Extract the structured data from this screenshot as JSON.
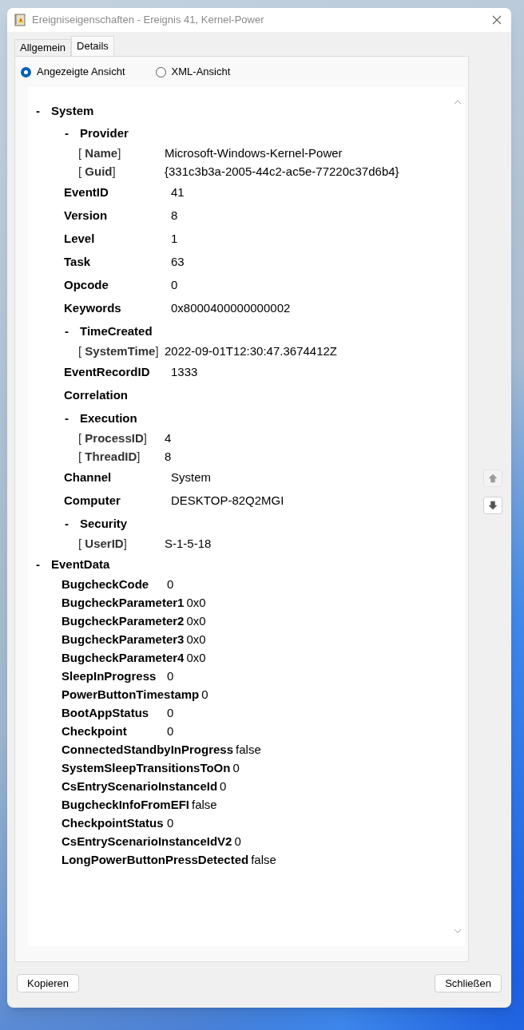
{
  "window": {
    "title": "Ereigniseigenschaften - Ereignis 41, Kernel-Power"
  },
  "tabs": [
    {
      "label": "Allgemein",
      "selected": false
    },
    {
      "label": "Details",
      "selected": true
    }
  ],
  "view_options": [
    {
      "label": "Angezeigte Ansicht",
      "selected": true
    },
    {
      "label": "XML-Ansicht",
      "selected": false
    }
  ],
  "tree": [
    {
      "kind": "group",
      "toggle": "-",
      "label": "System",
      "children": [
        {
          "kind": "group",
          "toggle": "-",
          "label": "Provider",
          "children": [
            {
              "kind": "attribute",
              "name": "[ **Name**]",
              "value": "Microsoft-Windows-Kernel-Power"
            },
            {
              "kind": "attribute",
              "name": "[ **Guid**]",
              "value": "{331c3b3a-2005-44c2-ac5e-77220c37d6b4}"
            }
          ]
        },
        {
          "kind": "field",
          "name": "EventID",
          "value": "41"
        },
        {
          "kind": "field",
          "name": "Version",
          "value": "8"
        },
        {
          "kind": "field",
          "name": "Level",
          "value": "1"
        },
        {
          "kind": "field",
          "name": "Task",
          "value": "63"
        },
        {
          "kind": "field",
          "name": "Opcode",
          "value": "0"
        },
        {
          "kind": "field",
          "name": "Keywords",
          "value": "0x8000400000000002"
        },
        {
          "kind": "group",
          "toggle": "-",
          "label": "TimeCreated",
          "children": [
            {
              "kind": "attribute",
              "name": "[ **SystemTime**]",
              "value": "2022-09-01T12:30:47.3674412Z"
            }
          ]
        },
        {
          "kind": "field",
          "name": "EventRecordID",
          "value": "1333"
        },
        {
          "kind": "field",
          "name": "Correlation"
        },
        {
          "kind": "group",
          "toggle": "-",
          "label": "Execution",
          "children": [
            {
              "kind": "attribute",
              "name": "[ **ProcessID**]",
              "value": "4"
            },
            {
              "kind": "attribute",
              "name": "[ **ThreadID**]",
              "value": "8"
            }
          ]
        },
        {
          "kind": "field",
          "name": "Channel",
          "value": "System"
        },
        {
          "kind": "field",
          "name": "Computer",
          "value": "DESKTOP-82Q2MGI"
        },
        {
          "kind": "group",
          "toggle": "-",
          "label": "Security",
          "children": [
            {
              "kind": "attribute",
              "name": "[ **UserID**]",
              "value": "S-1-5-18"
            }
          ]
        }
      ]
    },
    {
      "kind": "group",
      "toggle": "-",
      "label": "EventData",
      "children": [
        {
          "kind": "data",
          "name": "BugcheckCode",
          "value": "0"
        },
        {
          "kind": "data",
          "name": "BugcheckParameter1",
          "value": "0x0"
        },
        {
          "kind": "data",
          "name": "BugcheckParameter2",
          "value": "0x0"
        },
        {
          "kind": "data",
          "name": "BugcheckParameter3",
          "value": "0x0"
        },
        {
          "kind": "data",
          "name": "BugcheckParameter4",
          "value": "0x0"
        },
        {
          "kind": "data",
          "name": "SleepInProgress",
          "value": "0"
        },
        {
          "kind": "data",
          "name": "PowerButtonTimestamp",
          "value": "0"
        },
        {
          "kind": "data",
          "name": "BootAppStatus",
          "value": "0"
        },
        {
          "kind": "data",
          "name": "Checkpoint",
          "value": "0"
        },
        {
          "kind": "data",
          "name": "ConnectedStandbyInProgress",
          "value": "false"
        },
        {
          "kind": "data",
          "name": "SystemSleepTransitionsToOn",
          "value": "0"
        },
        {
          "kind": "data",
          "name": "CsEntryScenarioInstanceId",
          "value": "0"
        },
        {
          "kind": "data",
          "name": "BugcheckInfoFromEFI",
          "value": "false"
        },
        {
          "kind": "data",
          "name": "CheckpointStatus",
          "value": "0"
        },
        {
          "kind": "data",
          "name": "CsEntryScenarioInstanceIdV2",
          "value": "0"
        },
        {
          "kind": "data",
          "name": "LongPowerButtonPressDetected",
          "value": "false"
        }
      ]
    }
  ],
  "nav_buttons": [
    {
      "kind": "up",
      "disabled": true
    },
    {
      "kind": "down",
      "disabled": false
    }
  ],
  "buttons": [
    {
      "label": "Kopieren"
    },
    {
      "label": "Schließen"
    }
  ]
}
